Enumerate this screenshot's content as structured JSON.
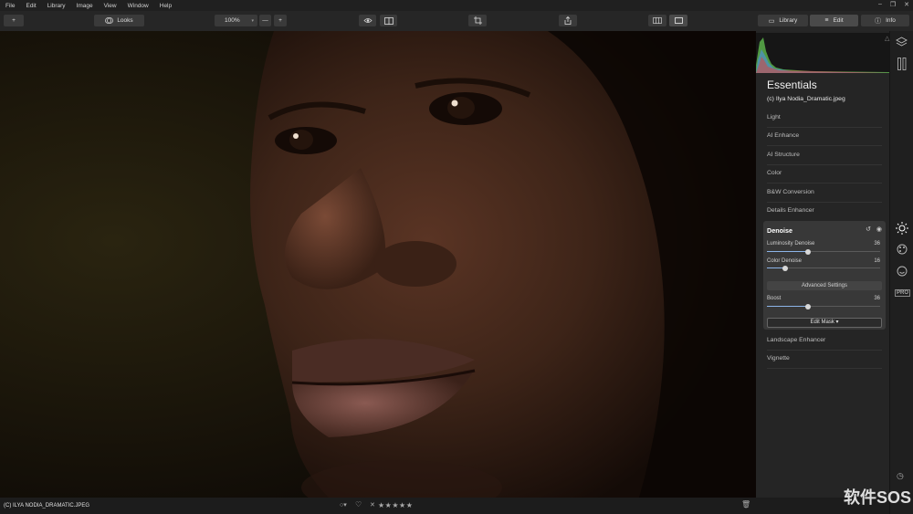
{
  "menu": {
    "items": [
      "File",
      "Edit",
      "Library",
      "Image",
      "View",
      "Window",
      "Help"
    ]
  },
  "toolbar": {
    "add_label": "+",
    "looks_label": "Looks",
    "zoom_value": "100%",
    "zoom_minus": "—",
    "zoom_plus": "+",
    "tabs": {
      "library": "Library",
      "edit": "Edit",
      "info": "Info"
    }
  },
  "panel": {
    "title": "Essentials",
    "filename": "(c) Ilya Nodia_Dramatic.jpeg",
    "sections_top": [
      "Light",
      "AI Enhance",
      "AI Structure",
      "Color",
      "B&W Conversion",
      "Details Enhancer"
    ],
    "denoise": {
      "title": "Denoise",
      "luminosity_label": "Luminosity Denoise",
      "luminosity_value": "36",
      "luminosity_fraction": 0.36,
      "color_label": "Color Denoise",
      "color_value": "16",
      "color_fraction": 0.16,
      "advanced_label": "Advanced Settings",
      "boost_label": "Boost",
      "boost_value": "36",
      "boost_fraction": 0.36,
      "edit_mask_label": "Edit Mask ▾"
    },
    "sections_bottom": [
      "Landscape Enhancer",
      "Vignette"
    ]
  },
  "rail": {
    "icons": [
      "layers-icon",
      "sun-icon",
      "palette-icon",
      "face-icon"
    ],
    "pro_label": "PRO"
  },
  "status": {
    "filename": "(C) ILYA NODIA_DRAMATIC.JPEG",
    "stars": "★★★★★",
    "reject": "✕"
  },
  "watermark": "软件SOS",
  "colors": {
    "accent": "#8cb4e8",
    "panel_bg": "#252525"
  }
}
